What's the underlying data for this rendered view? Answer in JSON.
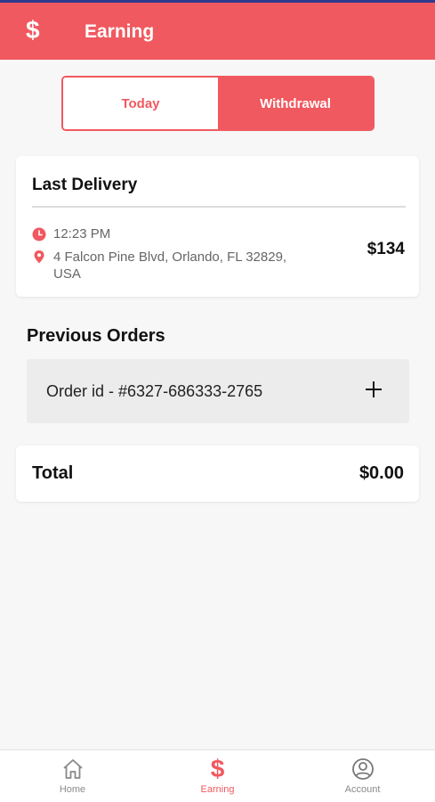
{
  "header": {
    "icon": "dollar-icon",
    "title": "Earning",
    "color": "#f0595f"
  },
  "toggle": {
    "today_label": "Today",
    "withdrawal_label": "Withdrawal",
    "active": "Withdrawal"
  },
  "last_delivery": {
    "heading": "Last Delivery",
    "time": "12:23 PM",
    "address": "4 Falcon Pine Blvd, Orlando, FL 32829, USA",
    "amount": "$134"
  },
  "previous_orders": {
    "title": "Previous Orders",
    "orders": [
      {
        "label": "Order id - #6327-686333-2765"
      }
    ]
  },
  "total": {
    "label": "Total",
    "value": "$0.00"
  },
  "bottom_nav": {
    "items": [
      {
        "label": "Home",
        "icon": "home-icon"
      },
      {
        "label": "Earning",
        "icon": "dollar-icon",
        "active": true
      },
      {
        "label": "Account",
        "icon": "account-icon"
      }
    ]
  }
}
